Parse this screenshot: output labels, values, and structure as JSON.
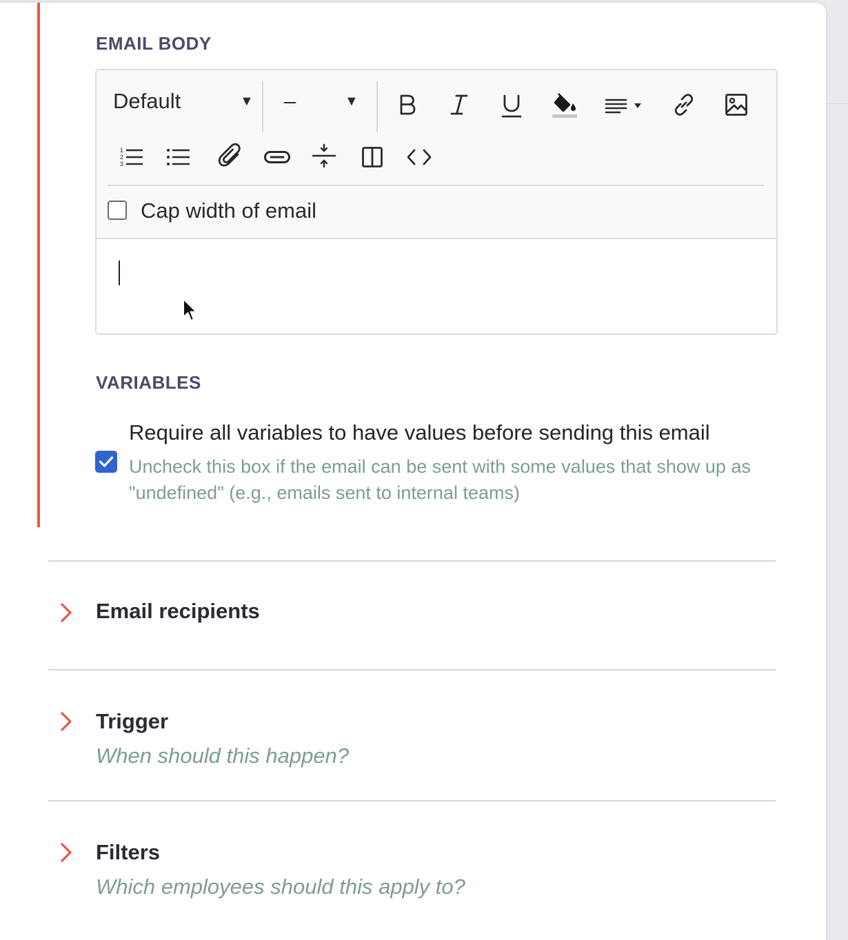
{
  "email_body": {
    "section_label": "EMAIL BODY",
    "toolbar": {
      "style_select_value": "Default",
      "size_select_value": "–",
      "buttons": [
        {
          "name": "bold-icon"
        },
        {
          "name": "italic-icon"
        },
        {
          "name": "underline-icon"
        },
        {
          "name": "fill-color-icon"
        },
        {
          "name": "align-icon"
        },
        {
          "name": "link-icon"
        },
        {
          "name": "image-icon"
        },
        {
          "name": "ordered-list-icon"
        },
        {
          "name": "bullet-list-icon"
        },
        {
          "name": "attachment-icon"
        },
        {
          "name": "button-icon"
        },
        {
          "name": "divider-icon"
        },
        {
          "name": "columns-icon"
        },
        {
          "name": "code-icon"
        }
      ]
    },
    "cap_width_checkbox": {
      "label": "Cap width of email",
      "checked": false
    },
    "content": ""
  },
  "variables": {
    "section_label": "VARIABLES",
    "require_checkbox": {
      "checked": true,
      "label": "Require all variables to have values before sending this email",
      "help": "Uncheck this box if the email can be sent with some values that show up as \"undefined\" (e.g., emails sent to internal teams)"
    }
  },
  "accordions": [
    {
      "title": "Email recipients",
      "subtitle": ""
    },
    {
      "title": "Trigger",
      "subtitle": "When should this happen?"
    },
    {
      "title": "Filters",
      "subtitle": "Which employees should this apply to?"
    }
  ],
  "colors": {
    "accent": "#e35a44",
    "checkbox_checked": "#2f63cf",
    "help_text": "#7f9c93",
    "section_label": "#4d4a68"
  }
}
